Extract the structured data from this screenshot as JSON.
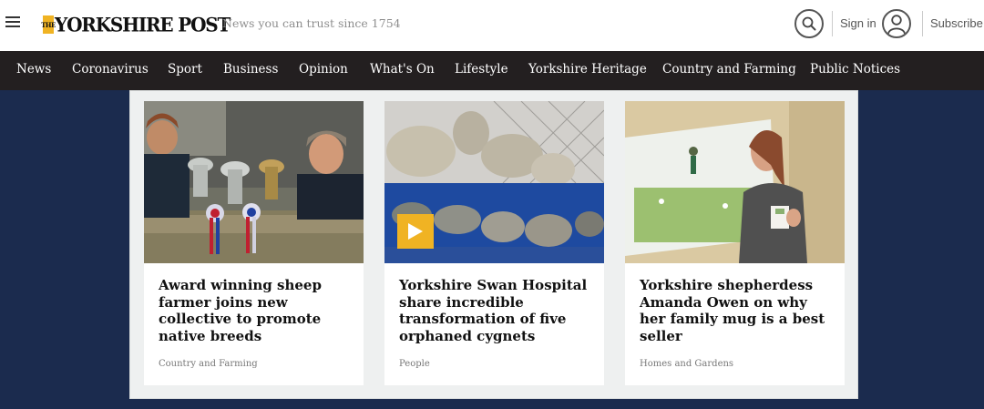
{
  "header": {
    "logo_the": "THE",
    "logo_text": "YORKSHIRE POST",
    "tagline": "News you can trust since 1754",
    "sign_in": "Sign in",
    "subscribe": "Subscribe",
    "icons": {
      "menu": "hamburger-menu-icon",
      "search": "search-icon",
      "account": "user-account-icon"
    }
  },
  "nav": {
    "items": [
      "News",
      "Coronavirus",
      "Sport",
      "Business",
      "Opinion",
      "What's On",
      "Lifestyle",
      "Yorkshire Heritage",
      "Country and Farming",
      "Public Notices"
    ]
  },
  "cards": [
    {
      "title": "Award winning sheep farmer joins new collective to promote native breeds",
      "tag": "Country and Farming",
      "has_video": false
    },
    {
      "title": "Yorkshire Swan Hospital share incredible transformation of five orphaned cygnets",
      "tag": "People",
      "has_video": true
    },
    {
      "title": "Yorkshire shepherdess Amanda Owen on why her family mug is a best seller",
      "tag": "Homes and Gardens",
      "has_video": false
    }
  ],
  "colors": {
    "brand_yellow": "#f0b323",
    "nav_background": "#231f20",
    "page_background": "#1b2b4e"
  }
}
